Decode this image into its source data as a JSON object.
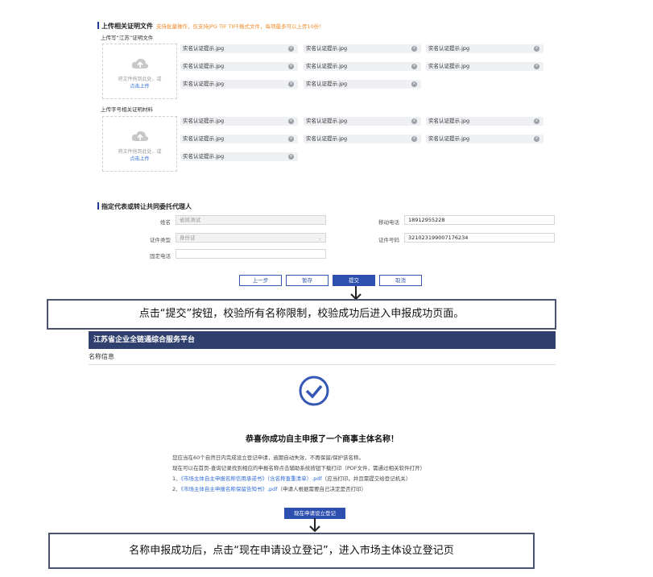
{
  "upload_section": {
    "title": "上传相关证明文件",
    "hint": "支持批量操作，仅支持JPG TIF TIFF格式文件，每项最多可以上传10份！",
    "group1_label": "上传写“江苏”证明文件",
    "group2_label": "上传字号相关证明材料",
    "dropzone_text": "将文件拖到此处，或",
    "dropzone_link": "点击上传",
    "file_name": "实名认证提示.jpg"
  },
  "agent_section": {
    "title": "指定代表或转让共同委托代理人",
    "name_label": "姓名",
    "name_value": "省局测试",
    "mobile_label": "移动电话",
    "mobile_value": "18912955228",
    "idtype_label": "证件类型",
    "idtype_value": "身份证",
    "idno_label": "证件号码",
    "idno_value": "321023199007176234",
    "phone_label": "固定电话",
    "phone_value": ""
  },
  "buttons": {
    "prev": "上一步",
    "save": "暂存",
    "submit": "提交",
    "cancel": "取消"
  },
  "callout1": "点击“提交”按钮，校验所有名称限制，校验成功后进入申报成功页面。",
  "success_page": {
    "banner": "江苏省企业全链通综合服务平台",
    "tab": "名称信息",
    "headline": "恭喜你成功自主申报了一个商事主体名称！",
    "line1": "您应当在60个自然日内完成设立登记申请，逾期自动失效，不再保留/保护该名称。",
    "line2": "现在可以在首页-查询记录找到相应的申报名称点击辅助系统按钮下载打印（PDF文件，需通过相关软件打开）",
    "line3_prefix": "1、",
    "line3_link": "《市场主体自主申报名称信用承诺书》（含名称查重清单）.pdf",
    "line3_suffix": "（应当打印，并且需提交给登记机关）",
    "line4_prefix": "2、",
    "line4_link": "《市场主体自主申报名称保留告知书》.pdf",
    "line4_suffix": "（申请人根据需要自己决定是否打印）",
    "register_button": "现在申请设立登记"
  },
  "callout2": "名称申报成功后，点击“现在申请设立登记”，进入市场主体设立登记页"
}
